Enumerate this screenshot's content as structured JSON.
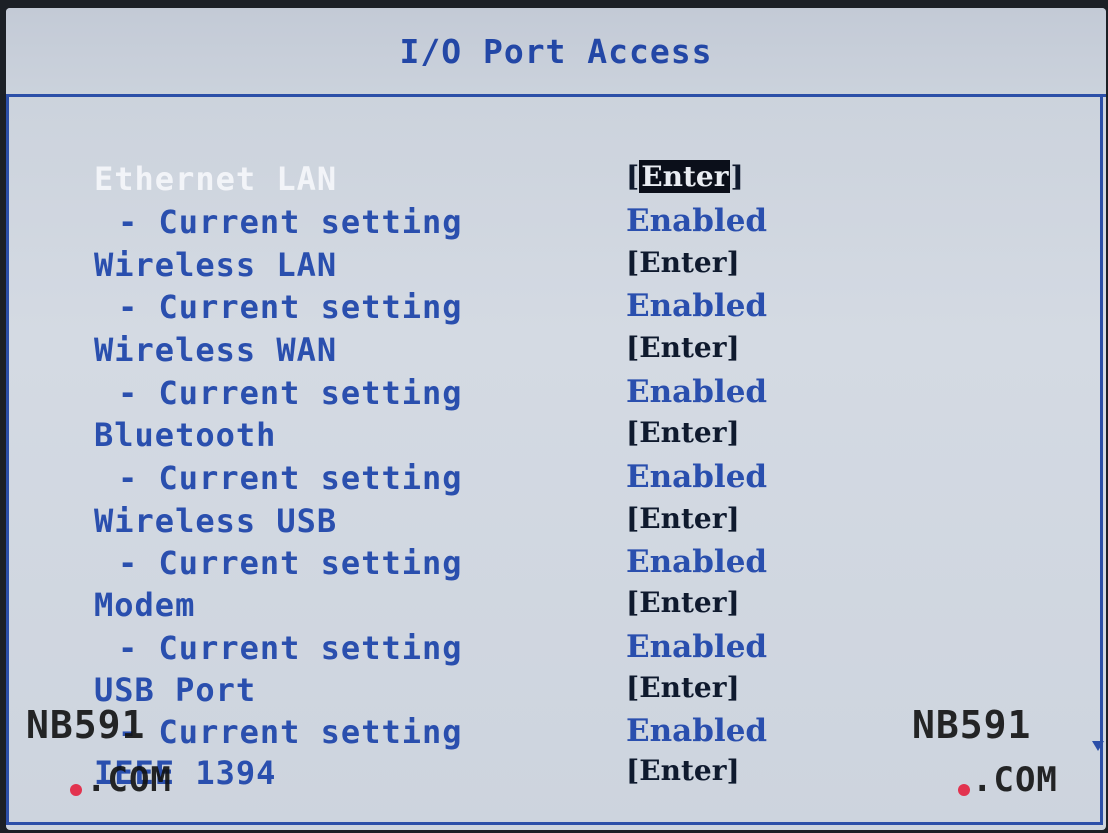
{
  "header": {
    "title": "I/O Port Access"
  },
  "items": [
    {
      "label": "Ethernet LAN",
      "value": "Enter",
      "selected": true
    },
    {
      "label": "- Current setting",
      "value": "Enabled"
    },
    {
      "label": "Wireless LAN",
      "value": "[Enter]"
    },
    {
      "label": "- Current setting",
      "value": "Enabled"
    },
    {
      "label": "Wireless WAN",
      "value": "[Enter]"
    },
    {
      "label": "- Current setting",
      "value": "Enabled"
    },
    {
      "label": "Bluetooth",
      "value": "[Enter]"
    },
    {
      "label": "- Current setting",
      "value": "Enabled"
    },
    {
      "label": "Wireless USB",
      "value": "[Enter]"
    },
    {
      "label": "- Current setting",
      "value": "Enabled"
    },
    {
      "label": "Modem",
      "value": "[Enter]"
    },
    {
      "label": "- Current setting",
      "value": "Enabled"
    },
    {
      "label": "USB Port",
      "value": "[Enter]"
    },
    {
      "label": "- Current setting",
      "value": "Enabled"
    },
    {
      "label": "IEEE 1394",
      "value": "[Enter]"
    }
  ],
  "watermark": {
    "top": "NB591",
    "bottom": ".COM"
  },
  "colors": {
    "accent": "#2a4fae",
    "selected_text": "#f2f4f8",
    "background": "#d0d7e1"
  }
}
